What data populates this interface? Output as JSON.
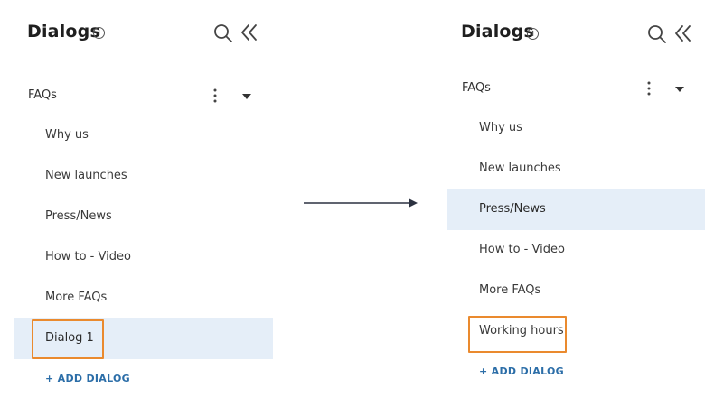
{
  "panels": [
    {
      "title": "Dialogs",
      "info_icon": "info-icon",
      "search_icon": "search-icon",
      "collapse_icon": "double-chevron-left-icon",
      "group": {
        "label": "FAQs",
        "menu_icon": "kebab-icon",
        "expand_icon": "caret-down-icon"
      },
      "items": [
        "Why us",
        "New launches",
        "Press/News",
        "How to - Video",
        "More FAQs",
        "Dialog 1"
      ],
      "selected_item": "Dialog 1",
      "highlighted_item": "Dialog 1",
      "add_button": "+ ADD DIALOG"
    },
    {
      "title": "Dialogs",
      "info_icon": "info-icon",
      "search_icon": "search-icon",
      "collapse_icon": "double-chevron-left-icon",
      "group": {
        "label": "FAQs",
        "menu_icon": "kebab-icon",
        "expand_icon": "caret-down-icon"
      },
      "items": [
        "Why us",
        "New launches",
        "Press/News",
        "How to - Video",
        "More FAQs",
        "Working hours"
      ],
      "selected_item": "Press/News",
      "highlighted_item": "Working hours",
      "add_button": "+ ADD DIALOG"
    }
  ],
  "transition_icon": "arrow-right-icon",
  "colors": {
    "selected_background": "#e5eef8",
    "highlight_border": "#ea8a2e",
    "link": "#2c6ea8",
    "text": "#333333"
  }
}
